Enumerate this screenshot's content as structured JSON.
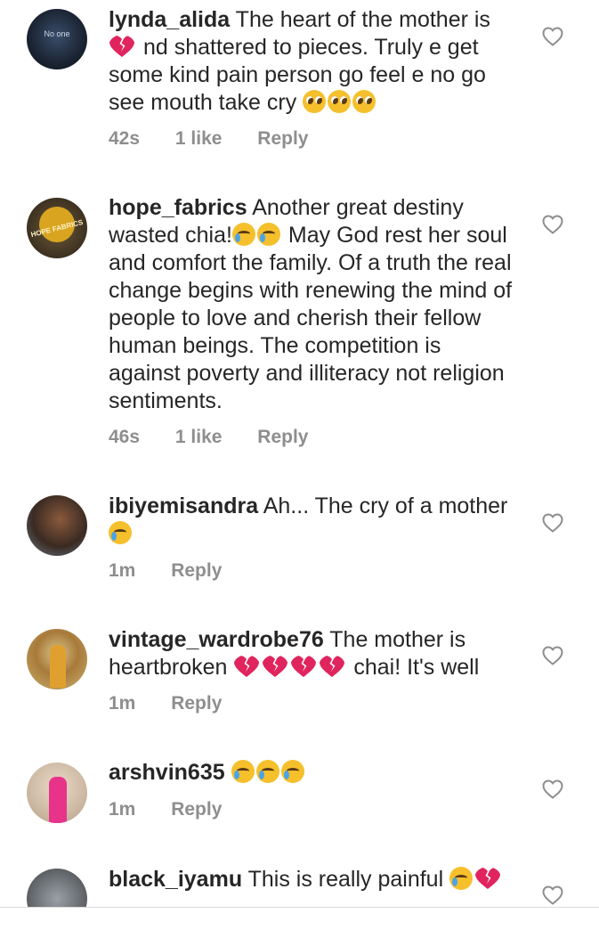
{
  "comments": [
    {
      "username": "lynda_alida",
      "text_parts": [
        "The heart of the mother is",
        "nd shattered to pieces. Truly e get some kind pain person go feel e no go see mouth take cry"
      ],
      "time": "42s",
      "likes": "1 like",
      "reply": "Reply",
      "avatar_label": "No one"
    },
    {
      "username": "hope_fabrics",
      "text_parts": [
        "Another great destiny wasted chia!",
        "May God rest her soul and comfort the family. Of a truth the real change begins with renewing the mind of people to love and cherish their fellow human beings. The competition is against poverty and illiteracy not religion sentiments."
      ],
      "time": "46s",
      "likes": "1 like",
      "reply": "Reply",
      "avatar_label": "HOPE FABRICS"
    },
    {
      "username": "ibiyemisandra",
      "text_parts": [
        "Ah... The cry of a mother"
      ],
      "time": "1m",
      "reply": "Reply"
    },
    {
      "username": "vintage_wardrobe76",
      "text_parts": [
        "The mother is heartbroken",
        "chai! It's well"
      ],
      "time": "1m",
      "reply": "Reply"
    },
    {
      "username": "arshvin635",
      "text_parts": [
        ""
      ],
      "time": "1m",
      "reply": "Reply"
    },
    {
      "username": "black_iyamu",
      "text_parts": [
        "This is really painful"
      ],
      "reply": ""
    }
  ],
  "icons": {
    "like": "heart-outline-icon"
  },
  "colors": {
    "text": "#262626",
    "meta": "#8e8e8e",
    "broken_heart": "#e0245e",
    "emoji": "#f5c02c"
  }
}
